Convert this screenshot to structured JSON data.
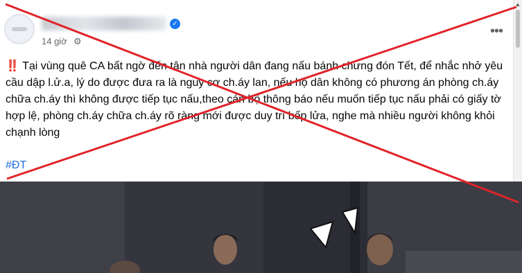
{
  "post": {
    "time": "14 giờ",
    "text_prefix": "‼️",
    "text_body": "Tại vùng quê CA bất ngờ đến tận nhà người dân đang nấu bánh chưng đón Tết, để nhắc nhở yêu cầu dập l.ử.a, lý do được đưa ra là nguy cơ ch.áy lan, nếu hộ dân không có phương án phòng ch.áy chữa ch.áy thì không được tiếp tục nấu,theo cán bộ thông báo nếu muốn tiếp tục nấu phải có giấy tờ hợp lệ, phòng ch.áy chữa ch.áy rõ ràng mới được duy trì bếp lửa, nghe mà nhiều người không khỏi chạnh lòng",
    "hashtag": "#ĐT"
  },
  "icons": {
    "verified": "verified-badge-icon",
    "privacy": "gear-icon",
    "more": "more-options-icon",
    "cross": "red-x-mark"
  },
  "colors": {
    "cross": "#e0242a",
    "hashtag": "#216fdb",
    "verified": "#1877f2",
    "meta_text": "#65676b"
  }
}
